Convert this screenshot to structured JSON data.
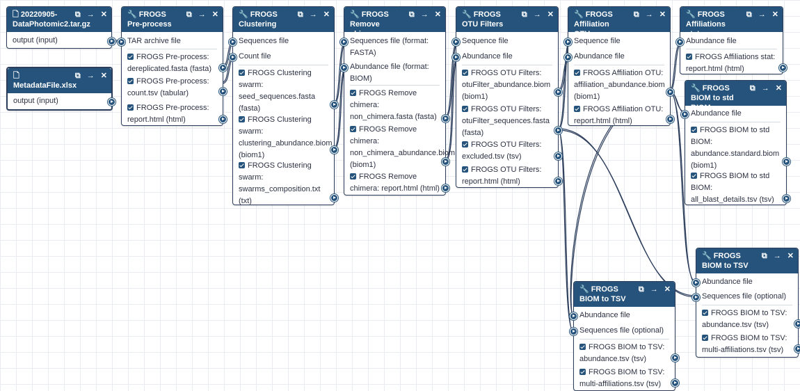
{
  "icons": {
    "copy": "⧉",
    "run": "→",
    "close": "✕",
    "file": "🗋",
    "tool": "🔧"
  },
  "nodes": {
    "n1": {
      "title": "20220905-DataPhotomic2.tar.gz",
      "output": "output (input)"
    },
    "n2": {
      "title": "MetadataFile.xlsx",
      "output": "output (input)"
    },
    "n3": {
      "title": "FROGS Pre-process",
      "inputs": [
        "TAR archive file"
      ],
      "outputs": [
        "FROGS Pre-process: dereplicated.fasta (fasta)",
        "FROGS Pre-process: count.tsv (tabular)",
        "FROGS Pre-process: report.html (html)"
      ]
    },
    "n4": {
      "title": "FROGS Clustering swarm",
      "inputs": [
        "Sequences file",
        "Count file"
      ],
      "outputs": [
        "FROGS Clustering swarm: seed_sequences.fasta (fasta)",
        "FROGS Clustering swarm: clustering_abundance.biom (biom1)",
        "FROGS Clustering swarm: swarms_composition.txt (txt)"
      ]
    },
    "n5": {
      "title": "FROGS Remove chimera",
      "inputs": [
        "Sequences file (format: FASTA)",
        "Abundance file (format: BIOM)"
      ],
      "outputs": [
        "FROGS Remove chimera: non_chimera.fasta (fasta)",
        "FROGS Remove chimera: non_chimera_abundance.biom (biom1)",
        "FROGS Remove chimera: report.html (html)"
      ]
    },
    "n6": {
      "title": "FROGS OTU Filters",
      "inputs": [
        "Sequence file",
        "Abundance file"
      ],
      "outputs": [
        "FROGS OTU Filters: otuFilter_abundance.biom (biom1)",
        "FROGS OTU Filters: otuFilter_sequences.fasta (fasta)",
        "FROGS OTU Filters: excluded.tsv (tsv)",
        "FROGS OTU Filters: report.html (html)"
      ]
    },
    "n7": {
      "title": "FROGS Affiliation OTU",
      "inputs": [
        "Sequence file",
        "Abundance file"
      ],
      "outputs": [
        "FROGS Affiliation OTU: affiliation_abundance.biom (biom1)",
        "FROGS Affiliation OTU: report.html (html)"
      ]
    },
    "n8": {
      "title": "FROGS Affiliations stat",
      "inputs": [
        "Abundance file"
      ],
      "outputs": [
        "FROGS Affiliations stat: report.html (html)"
      ]
    },
    "n9": {
      "title": "FROGS BIOM to std BIOM",
      "inputs": [
        "Abundance file"
      ],
      "outputs": [
        "FROGS BIOM to std BIOM: abundance.standard.biom (biom1)",
        "FROGS BIOM to std BIOM: all_blast_details.tsv (tsv)"
      ]
    },
    "n10": {
      "title": "FROGS BIOM to TSV",
      "inputs": [
        "Abundance file",
        "Sequences file (optional)"
      ],
      "outputs": [
        "FROGS BIOM to TSV: abundance.tsv (tsv)",
        "FROGS BIOM to TSV: multi-affiliations.tsv (tsv)"
      ]
    },
    "n11": {
      "title": "FROGS BIOM to TSV",
      "inputs": [
        "Abundance file",
        "Sequences file (optional)"
      ],
      "outputs": [
        "FROGS BIOM to TSV: abundance.tsv (tsv)",
        "FROGS BIOM to TSV: multi-affiliations.tsv (tsv)"
      ]
    }
  }
}
